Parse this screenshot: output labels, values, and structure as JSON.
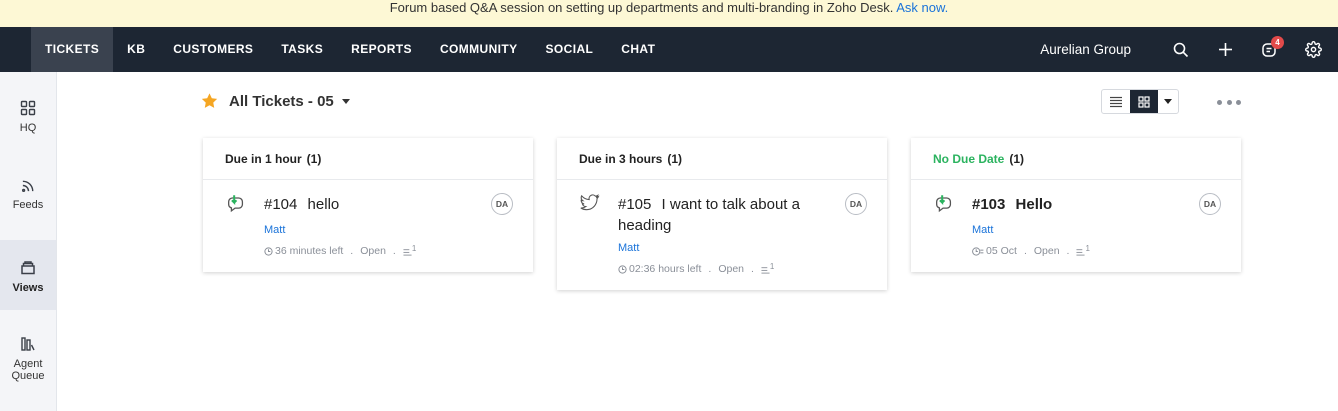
{
  "banner": {
    "text": "Forum based Q&A session on setting up departments and multi-branding in Zoho Desk. ",
    "link": "Ask now."
  },
  "topnav": {
    "items": [
      "TICKETS",
      "KB",
      "CUSTOMERS",
      "TASKS",
      "REPORTS",
      "COMMUNITY",
      "SOCIAL",
      "CHAT"
    ],
    "active": "TICKETS",
    "org": "Aurelian Group",
    "notification_count": "4",
    "icons": [
      "search-icon",
      "plus-icon",
      "notification-icon",
      "gear-icon"
    ]
  },
  "sidebar": {
    "items": [
      {
        "label": "HQ",
        "icon": "grid-icon"
      },
      {
        "label": "Feeds",
        "icon": "rss-icon"
      },
      {
        "label": "Views",
        "icon": "views-icon",
        "active": true
      },
      {
        "label": "Agent Queue",
        "icon": "agent-queue-icon"
      }
    ]
  },
  "view": {
    "title": "All Tickets - 05",
    "favorite_color": "#f5a623"
  },
  "columns": [
    {
      "title": "Due in 1 hour",
      "count": "(1)",
      "title_color": "#222222",
      "ticket": {
        "number": "#104",
        "subject": "hello",
        "channel": "web-icon",
        "avatar": "DA",
        "assignee": "Matt",
        "due": "36 minutes left",
        "status": "Open",
        "threads": "1"
      }
    },
    {
      "title": "Due in 3 hours",
      "count": "(1)",
      "title_color": "#222222",
      "ticket": {
        "number": "#105",
        "subject": "I want to talk about a heading",
        "channel": "twitter-icon",
        "avatar": "DA",
        "assignee": "Matt",
        "due": "02:36 hours left",
        "status": "Open",
        "threads": "1"
      }
    },
    {
      "title": "No Due Date",
      "count": "(1)",
      "title_color": "#2bb35f",
      "ticket": {
        "number": "#103",
        "subject": "Hello",
        "channel": "web-icon",
        "avatar": "DA",
        "assignee": "Matt",
        "due": "05 Oct",
        "status": "Open",
        "threads": "1"
      }
    }
  ],
  "colors": {
    "nav_bg": "#1d2633",
    "banner_bg": "#fdf8d5",
    "link": "#1a73d9",
    "badge": "#e24a4a"
  }
}
